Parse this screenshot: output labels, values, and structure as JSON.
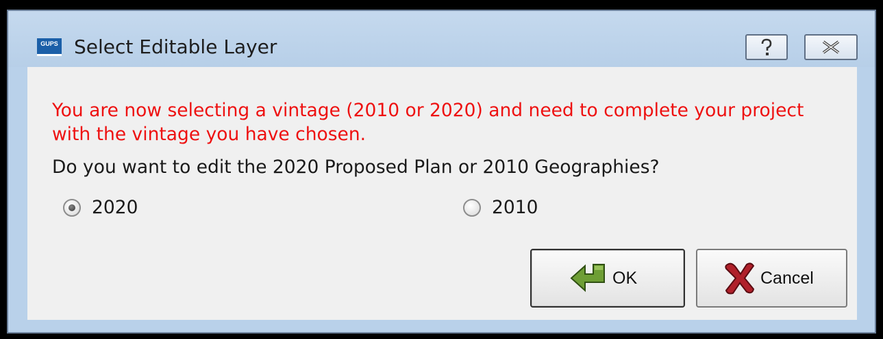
{
  "window": {
    "title": "Select Editable Layer",
    "app_icon_text": "GUPS",
    "help_icon": "question-mark-icon",
    "close_icon": "close-x-icon"
  },
  "message": {
    "warning": "You are now selecting a vintage (2010 or 2020) and need to complete your project with the vintage you have chosen.",
    "warning_color": "#ee1111",
    "question": "Do you want to edit the 2020 Proposed Plan or 2010 Geographies?"
  },
  "options": [
    {
      "label": "2020",
      "selected": true
    },
    {
      "label": "2010",
      "selected": false
    }
  ],
  "buttons": {
    "ok_label": "OK",
    "ok_icon": "green-arrow-icon",
    "cancel_label": "Cancel",
    "cancel_icon": "red-x-icon"
  }
}
